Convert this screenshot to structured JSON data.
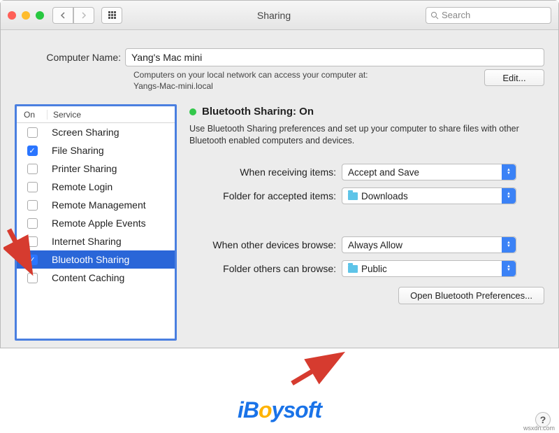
{
  "window": {
    "title": "Sharing"
  },
  "search": {
    "placeholder": "Search"
  },
  "computer": {
    "label": "Computer Name:",
    "value": "Yang's Mac mini",
    "hint1": "Computers on your local network can access your computer at:",
    "hint2": "Yangs-Mac-mini.local",
    "edit_label": "Edit..."
  },
  "services": {
    "col_on": "On",
    "col_service": "Service",
    "items": [
      {
        "label": "Screen Sharing",
        "checked": false,
        "selected": false
      },
      {
        "label": "File Sharing",
        "checked": true,
        "selected": false
      },
      {
        "label": "Printer Sharing",
        "checked": false,
        "selected": false
      },
      {
        "label": "Remote Login",
        "checked": false,
        "selected": false
      },
      {
        "label": "Remote Management",
        "checked": false,
        "selected": false
      },
      {
        "label": "Remote Apple Events",
        "checked": false,
        "selected": false
      },
      {
        "label": "Internet Sharing",
        "checked": false,
        "selected": false
      },
      {
        "label": "Bluetooth Sharing",
        "checked": true,
        "selected": true
      },
      {
        "label": "Content Caching",
        "checked": false,
        "selected": false
      }
    ]
  },
  "detail": {
    "status": "Bluetooth Sharing: On",
    "desc": "Use Bluetooth Sharing preferences and set up your computer to share files with other Bluetooth enabled computers and devices.",
    "recv_label": "When receiving items:",
    "recv_value": "Accept and Save",
    "accepted_label": "Folder for accepted items:",
    "accepted_value": "Downloads",
    "browse_label": "When other devices browse:",
    "browse_value": "Always Allow",
    "others_label": "Folder others can browse:",
    "others_value": "Public",
    "open_prefs": "Open Bluetooth Preferences..."
  },
  "watermark": {
    "brand_i": "i",
    "brand_b": "B",
    "brand_o": "o",
    "brand_rest": "ysoft",
    "small": "wsxdn.com"
  }
}
